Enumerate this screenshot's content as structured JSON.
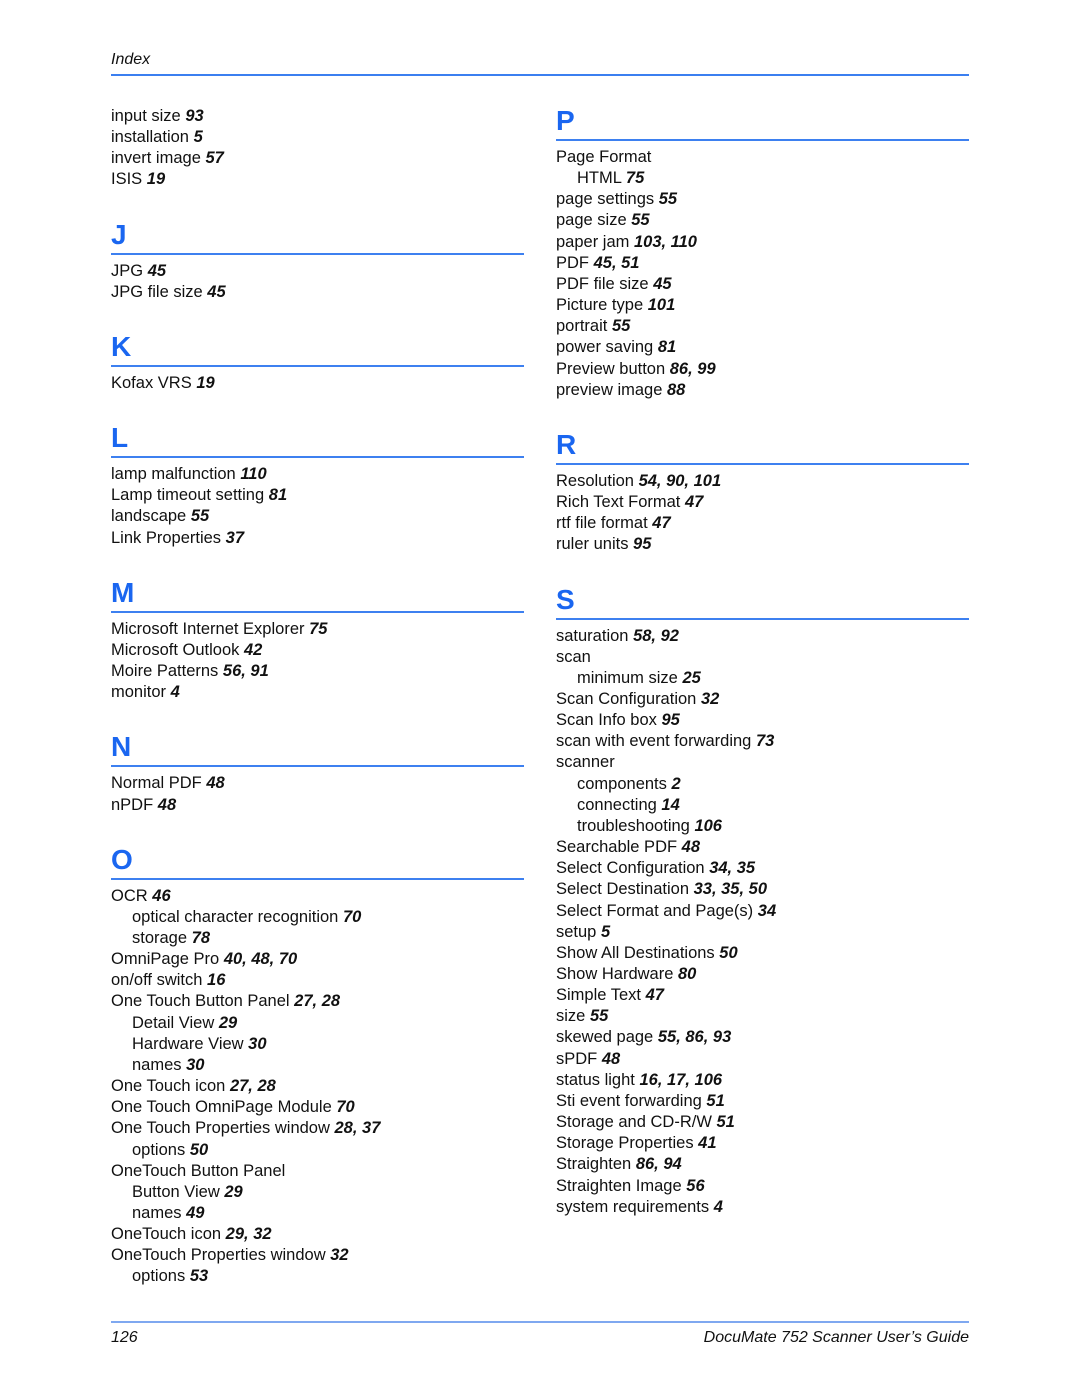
{
  "header": {
    "title": "Index"
  },
  "footer": {
    "page_number": "126",
    "book_title": "DocuMate 752 Scanner User’s Guide"
  },
  "colors": {
    "heading_blue": "#1a66f0",
    "rule_blue": "#3d80f0"
  },
  "left_column": {
    "lead_entries": [
      {
        "term": "input size",
        "pages": "93",
        "sub": false
      },
      {
        "term": "installation",
        "pages": "5",
        "sub": false
      },
      {
        "term": "invert image",
        "pages": "57",
        "sub": false
      },
      {
        "term": "ISIS",
        "pages": "19",
        "sub": false
      }
    ],
    "sections": [
      {
        "letter": "J",
        "entries": [
          {
            "term": "JPG",
            "pages": "45",
            "sub": false
          },
          {
            "term": "JPG file size",
            "pages": "45",
            "sub": false
          }
        ]
      },
      {
        "letter": "K",
        "entries": [
          {
            "term": "Kofax VRS",
            "pages": "19",
            "sub": false
          }
        ]
      },
      {
        "letter": "L",
        "entries": [
          {
            "term": "lamp malfunction",
            "pages": "110",
            "sub": false
          },
          {
            "term": "Lamp timeout setting",
            "pages": "81",
            "sub": false
          },
          {
            "term": "landscape",
            "pages": "55",
            "sub": false
          },
          {
            "term": "Link Properties",
            "pages": "37",
            "sub": false
          }
        ]
      },
      {
        "letter": "M",
        "entries": [
          {
            "term": "Microsoft Internet Explorer",
            "pages": "75",
            "sub": false
          },
          {
            "term": "Microsoft Outlook",
            "pages": "42",
            "sub": false
          },
          {
            "term": "Moire Patterns",
            "pages": "56, 91",
            "sub": false
          },
          {
            "term": "monitor",
            "pages": "4",
            "sub": false
          }
        ]
      },
      {
        "letter": "N",
        "entries": [
          {
            "term": "Normal PDF",
            "pages": "48",
            "sub": false
          },
          {
            "term": "nPDF",
            "pages": "48",
            "sub": false
          }
        ]
      },
      {
        "letter": "O",
        "entries": [
          {
            "term": "OCR",
            "pages": "46",
            "sub": false
          },
          {
            "term": "optical character recognition",
            "pages": "70",
            "sub": true
          },
          {
            "term": "storage",
            "pages": "78",
            "sub": true
          },
          {
            "term": "OmniPage Pro",
            "pages": "40, 48, 70",
            "sub": false
          },
          {
            "term": "on/off switch",
            "pages": "16",
            "sub": false
          },
          {
            "term": "One Touch Button Panel",
            "pages": "27, 28",
            "sub": false
          },
          {
            "term": "Detail View",
            "pages": "29",
            "sub": true
          },
          {
            "term": "Hardware View",
            "pages": "30",
            "sub": true
          },
          {
            "term": "names",
            "pages": "30",
            "sub": true
          },
          {
            "term": "One Touch icon",
            "pages": "27, 28",
            "sub": false
          },
          {
            "term": "One Touch OmniPage Module",
            "pages": "70",
            "sub": false
          },
          {
            "term": "One Touch Properties window",
            "pages": "28, 37",
            "sub": false
          },
          {
            "term": "options",
            "pages": "50",
            "sub": true
          },
          {
            "term": "OneTouch Button Panel",
            "pages": "",
            "sub": false
          },
          {
            "term": "Button View",
            "pages": "29",
            "sub": true
          },
          {
            "term": "names",
            "pages": "49",
            "sub": true
          },
          {
            "term": "OneTouch icon",
            "pages": "29, 32",
            "sub": false
          },
          {
            "term": "OneTouch Properties window",
            "pages": "32",
            "sub": false
          },
          {
            "term": "options",
            "pages": "53",
            "sub": true
          }
        ]
      }
    ]
  },
  "right_column": {
    "sections": [
      {
        "letter": "P",
        "entries": [
          {
            "term": "Page Format",
            "pages": "",
            "sub": false
          },
          {
            "term": "HTML",
            "pages": "75",
            "sub": true
          },
          {
            "term": "page settings",
            "pages": "55",
            "sub": false
          },
          {
            "term": "page size",
            "pages": "55",
            "sub": false
          },
          {
            "term": "paper jam",
            "pages": "103, 110",
            "sub": false
          },
          {
            "term": "PDF",
            "pages": "45, 51",
            "sub": false
          },
          {
            "term": "PDF file size",
            "pages": "45",
            "sub": false
          },
          {
            "term": "Picture type",
            "pages": "101",
            "sub": false
          },
          {
            "term": "portrait",
            "pages": "55",
            "sub": false
          },
          {
            "term": "power saving",
            "pages": "81",
            "sub": false
          },
          {
            "term": "Preview button",
            "pages": "86, 99",
            "sub": false
          },
          {
            "term": "preview image",
            "pages": "88",
            "sub": false
          }
        ]
      },
      {
        "letter": "R",
        "entries": [
          {
            "term": "Resolution",
            "pages": "54, 90, 101",
            "sub": false
          },
          {
            "term": "Rich Text Format",
            "pages": "47",
            "sub": false
          },
          {
            "term": "rtf file format",
            "pages": "47",
            "sub": false
          },
          {
            "term": "ruler units",
            "pages": "95",
            "sub": false
          }
        ]
      },
      {
        "letter": "S",
        "entries": [
          {
            "term": "saturation",
            "pages": "58, 92",
            "sub": false
          },
          {
            "term": "scan",
            "pages": "",
            "sub": false
          },
          {
            "term": "minimum size",
            "pages": "25",
            "sub": true
          },
          {
            "term": "Scan Configuration",
            "pages": "32",
            "sub": false
          },
          {
            "term": "Scan Info box",
            "pages": "95",
            "sub": false
          },
          {
            "term": "scan with event forwarding",
            "pages": "73",
            "sub": false
          },
          {
            "term": "scanner",
            "pages": "",
            "sub": false
          },
          {
            "term": "components",
            "pages": "2",
            "sub": true
          },
          {
            "term": "connecting",
            "pages": "14",
            "sub": true
          },
          {
            "term": "troubleshooting",
            "pages": "106",
            "sub": true
          },
          {
            "term": "Searchable PDF",
            "pages": "48",
            "sub": false
          },
          {
            "term": "Select Configuration",
            "pages": "34, 35",
            "sub": false
          },
          {
            "term": "Select Destination",
            "pages": "33, 35, 50",
            "sub": false
          },
          {
            "term": "Select Format and Page(s)",
            "pages": "34",
            "sub": false
          },
          {
            "term": "setup",
            "pages": "5",
            "sub": false
          },
          {
            "term": "Show All Destinations",
            "pages": "50",
            "sub": false
          },
          {
            "term": "Show Hardware",
            "pages": "80",
            "sub": false
          },
          {
            "term": "Simple Text",
            "pages": "47",
            "sub": false
          },
          {
            "term": "size",
            "pages": "55",
            "sub": false
          },
          {
            "term": "skewed page",
            "pages": "55, 86, 93",
            "sub": false
          },
          {
            "term": "sPDF",
            "pages": "48",
            "sub": false
          },
          {
            "term": "status light",
            "pages": "16, 17, 106",
            "sub": false
          },
          {
            "term": "Sti event forwarding",
            "pages": "51",
            "sub": false
          },
          {
            "term": "Storage and CD-R/W",
            "pages": "51",
            "sub": false
          },
          {
            "term": "Storage Properties",
            "pages": "41",
            "sub": false
          },
          {
            "term": "Straighten",
            "pages": "86, 94",
            "sub": false
          },
          {
            "term": "Straighten Image",
            "pages": "56",
            "sub": false
          },
          {
            "term": "system requirements",
            "pages": "4",
            "sub": false
          }
        ]
      }
    ]
  }
}
